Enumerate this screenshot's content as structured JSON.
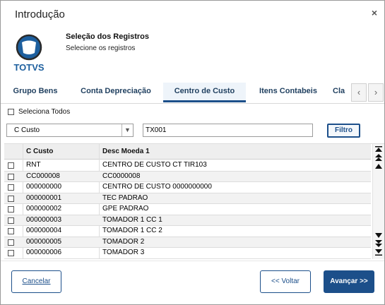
{
  "window": {
    "title": "Introdução",
    "close_glyph": "×"
  },
  "header": {
    "logo_text": "TOTVS",
    "title": "Seleção dos Registros",
    "subtitle": "Selecione os registros"
  },
  "tabs": [
    {
      "label": "Grupo Bens",
      "active": false
    },
    {
      "label": "Conta Depreciação",
      "active": false
    },
    {
      "label": "Centro de Custo",
      "active": true
    },
    {
      "label": "Itens Contabeis",
      "active": false
    },
    {
      "label": "Cla",
      "active": false
    }
  ],
  "tab_nav": {
    "prev_glyph": "‹",
    "next_glyph": "›"
  },
  "select_all_label": "Seleciona Todos",
  "filter": {
    "field_selected": "C Custo",
    "value": "TX001",
    "button_label": "Filtro"
  },
  "grid": {
    "columns": [
      "C Custo",
      "Desc Moeda 1"
    ],
    "rows": [
      [
        "RNT",
        "CENTRO DE CUSTO CT TIR103"
      ],
      [
        "CC000008",
        "CC0000008"
      ],
      [
        "000000000",
        "CENTRO DE CUSTO 0000000000"
      ],
      [
        "000000001",
        "TEC PADRAO"
      ],
      [
        "000000002",
        "GPE PADRAO"
      ],
      [
        "000000003",
        "TOMADOR 1 CC 1"
      ],
      [
        "000000004",
        "TOMADOR 1 CC 2"
      ],
      [
        "000000005",
        "TOMADOR 2"
      ],
      [
        "000000006",
        "TOMADOR 3"
      ]
    ]
  },
  "scrollbar_icons": [
    "scroll-top-icon",
    "page-up-icon",
    "line-up-icon",
    "line-down-icon",
    "page-down-icon",
    "scroll-bottom-icon"
  ],
  "footer": {
    "cancel_label": "Cancelar",
    "back_label": "<< Voltar",
    "next_label": "Avançar >>"
  },
  "colors": {
    "accent": "#1c4f8a",
    "logo_blue": "#1d5f9e",
    "logo_dark": "#2a2a2a"
  }
}
